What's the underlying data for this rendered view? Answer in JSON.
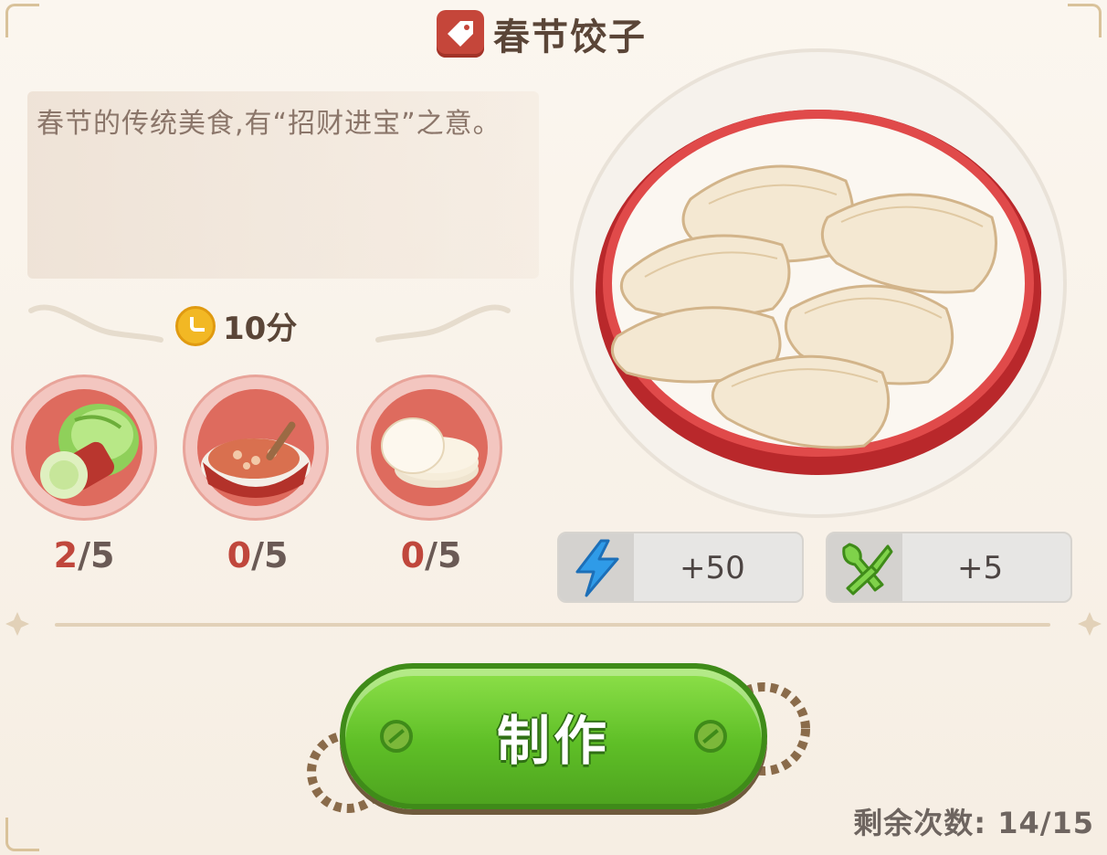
{
  "recipe": {
    "title": "春节饺子",
    "description": "春节的传统美食,有“招财进宝”之意。",
    "time": "10分"
  },
  "ingredients": [
    {
      "name": "cabbage",
      "count": "2/5",
      "have": "2",
      "need": "/5"
    },
    {
      "name": "meat-filling",
      "count": "0/5",
      "have": "0",
      "need": "/5"
    },
    {
      "name": "dumpling-wrappers",
      "count": "0/5",
      "have": "0",
      "need": "/5"
    }
  ],
  "stats": {
    "energy": "+50",
    "food": "+5"
  },
  "action": {
    "make_label": "制作"
  },
  "remaining": {
    "label": "剩余次数:",
    "value": "14/15"
  },
  "colors": {
    "title_text": "#5a4537",
    "button_green": "#5fbf27",
    "tag_red": "#c5463a",
    "count_red": "#c0473c"
  }
}
